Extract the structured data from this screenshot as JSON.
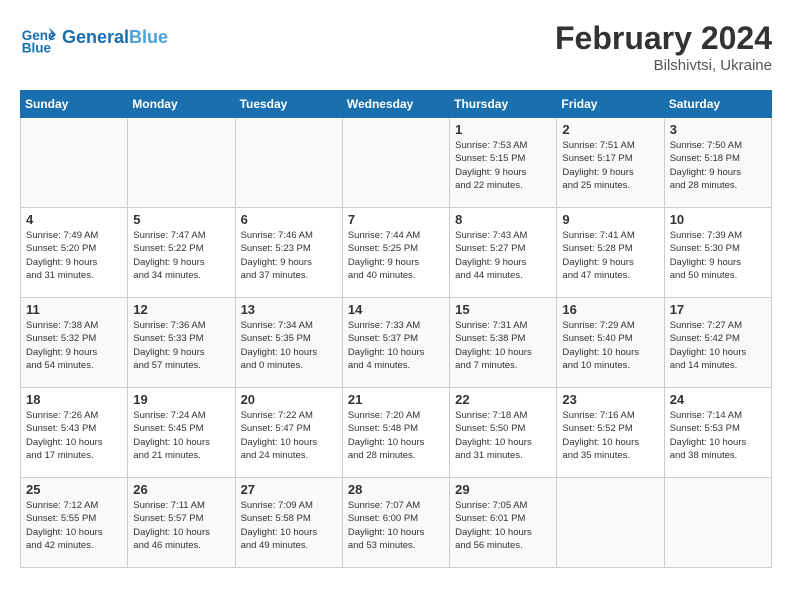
{
  "header": {
    "logo_general": "General",
    "logo_blue": "Blue",
    "title": "February 2024",
    "subtitle": "Bilshivtsi, Ukraine"
  },
  "weekdays": [
    "Sunday",
    "Monday",
    "Tuesday",
    "Wednesday",
    "Thursday",
    "Friday",
    "Saturday"
  ],
  "weeks": [
    [
      {
        "day": "",
        "detail": ""
      },
      {
        "day": "",
        "detail": ""
      },
      {
        "day": "",
        "detail": ""
      },
      {
        "day": "",
        "detail": ""
      },
      {
        "day": "1",
        "detail": "Sunrise: 7:53 AM\nSunset: 5:15 PM\nDaylight: 9 hours\nand 22 minutes."
      },
      {
        "day": "2",
        "detail": "Sunrise: 7:51 AM\nSunset: 5:17 PM\nDaylight: 9 hours\nand 25 minutes."
      },
      {
        "day": "3",
        "detail": "Sunrise: 7:50 AM\nSunset: 5:18 PM\nDaylight: 9 hours\nand 28 minutes."
      }
    ],
    [
      {
        "day": "4",
        "detail": "Sunrise: 7:49 AM\nSunset: 5:20 PM\nDaylight: 9 hours\nand 31 minutes."
      },
      {
        "day": "5",
        "detail": "Sunrise: 7:47 AM\nSunset: 5:22 PM\nDaylight: 9 hours\nand 34 minutes."
      },
      {
        "day": "6",
        "detail": "Sunrise: 7:46 AM\nSunset: 5:23 PM\nDaylight: 9 hours\nand 37 minutes."
      },
      {
        "day": "7",
        "detail": "Sunrise: 7:44 AM\nSunset: 5:25 PM\nDaylight: 9 hours\nand 40 minutes."
      },
      {
        "day": "8",
        "detail": "Sunrise: 7:43 AM\nSunset: 5:27 PM\nDaylight: 9 hours\nand 44 minutes."
      },
      {
        "day": "9",
        "detail": "Sunrise: 7:41 AM\nSunset: 5:28 PM\nDaylight: 9 hours\nand 47 minutes."
      },
      {
        "day": "10",
        "detail": "Sunrise: 7:39 AM\nSunset: 5:30 PM\nDaylight: 9 hours\nand 50 minutes."
      }
    ],
    [
      {
        "day": "11",
        "detail": "Sunrise: 7:38 AM\nSunset: 5:32 PM\nDaylight: 9 hours\nand 54 minutes."
      },
      {
        "day": "12",
        "detail": "Sunrise: 7:36 AM\nSunset: 5:33 PM\nDaylight: 9 hours\nand 57 minutes."
      },
      {
        "day": "13",
        "detail": "Sunrise: 7:34 AM\nSunset: 5:35 PM\nDaylight: 10 hours\nand 0 minutes."
      },
      {
        "day": "14",
        "detail": "Sunrise: 7:33 AM\nSunset: 5:37 PM\nDaylight: 10 hours\nand 4 minutes."
      },
      {
        "day": "15",
        "detail": "Sunrise: 7:31 AM\nSunset: 5:38 PM\nDaylight: 10 hours\nand 7 minutes."
      },
      {
        "day": "16",
        "detail": "Sunrise: 7:29 AM\nSunset: 5:40 PM\nDaylight: 10 hours\nand 10 minutes."
      },
      {
        "day": "17",
        "detail": "Sunrise: 7:27 AM\nSunset: 5:42 PM\nDaylight: 10 hours\nand 14 minutes."
      }
    ],
    [
      {
        "day": "18",
        "detail": "Sunrise: 7:26 AM\nSunset: 5:43 PM\nDaylight: 10 hours\nand 17 minutes."
      },
      {
        "day": "19",
        "detail": "Sunrise: 7:24 AM\nSunset: 5:45 PM\nDaylight: 10 hours\nand 21 minutes."
      },
      {
        "day": "20",
        "detail": "Sunrise: 7:22 AM\nSunset: 5:47 PM\nDaylight: 10 hours\nand 24 minutes."
      },
      {
        "day": "21",
        "detail": "Sunrise: 7:20 AM\nSunset: 5:48 PM\nDaylight: 10 hours\nand 28 minutes."
      },
      {
        "day": "22",
        "detail": "Sunrise: 7:18 AM\nSunset: 5:50 PM\nDaylight: 10 hours\nand 31 minutes."
      },
      {
        "day": "23",
        "detail": "Sunrise: 7:16 AM\nSunset: 5:52 PM\nDaylight: 10 hours\nand 35 minutes."
      },
      {
        "day": "24",
        "detail": "Sunrise: 7:14 AM\nSunset: 5:53 PM\nDaylight: 10 hours\nand 38 minutes."
      }
    ],
    [
      {
        "day": "25",
        "detail": "Sunrise: 7:12 AM\nSunset: 5:55 PM\nDaylight: 10 hours\nand 42 minutes."
      },
      {
        "day": "26",
        "detail": "Sunrise: 7:11 AM\nSunset: 5:57 PM\nDaylight: 10 hours\nand 46 minutes."
      },
      {
        "day": "27",
        "detail": "Sunrise: 7:09 AM\nSunset: 5:58 PM\nDaylight: 10 hours\nand 49 minutes."
      },
      {
        "day": "28",
        "detail": "Sunrise: 7:07 AM\nSunset: 6:00 PM\nDaylight: 10 hours\nand 53 minutes."
      },
      {
        "day": "29",
        "detail": "Sunrise: 7:05 AM\nSunset: 6:01 PM\nDaylight: 10 hours\nand 56 minutes."
      },
      {
        "day": "",
        "detail": ""
      },
      {
        "day": "",
        "detail": ""
      }
    ]
  ]
}
